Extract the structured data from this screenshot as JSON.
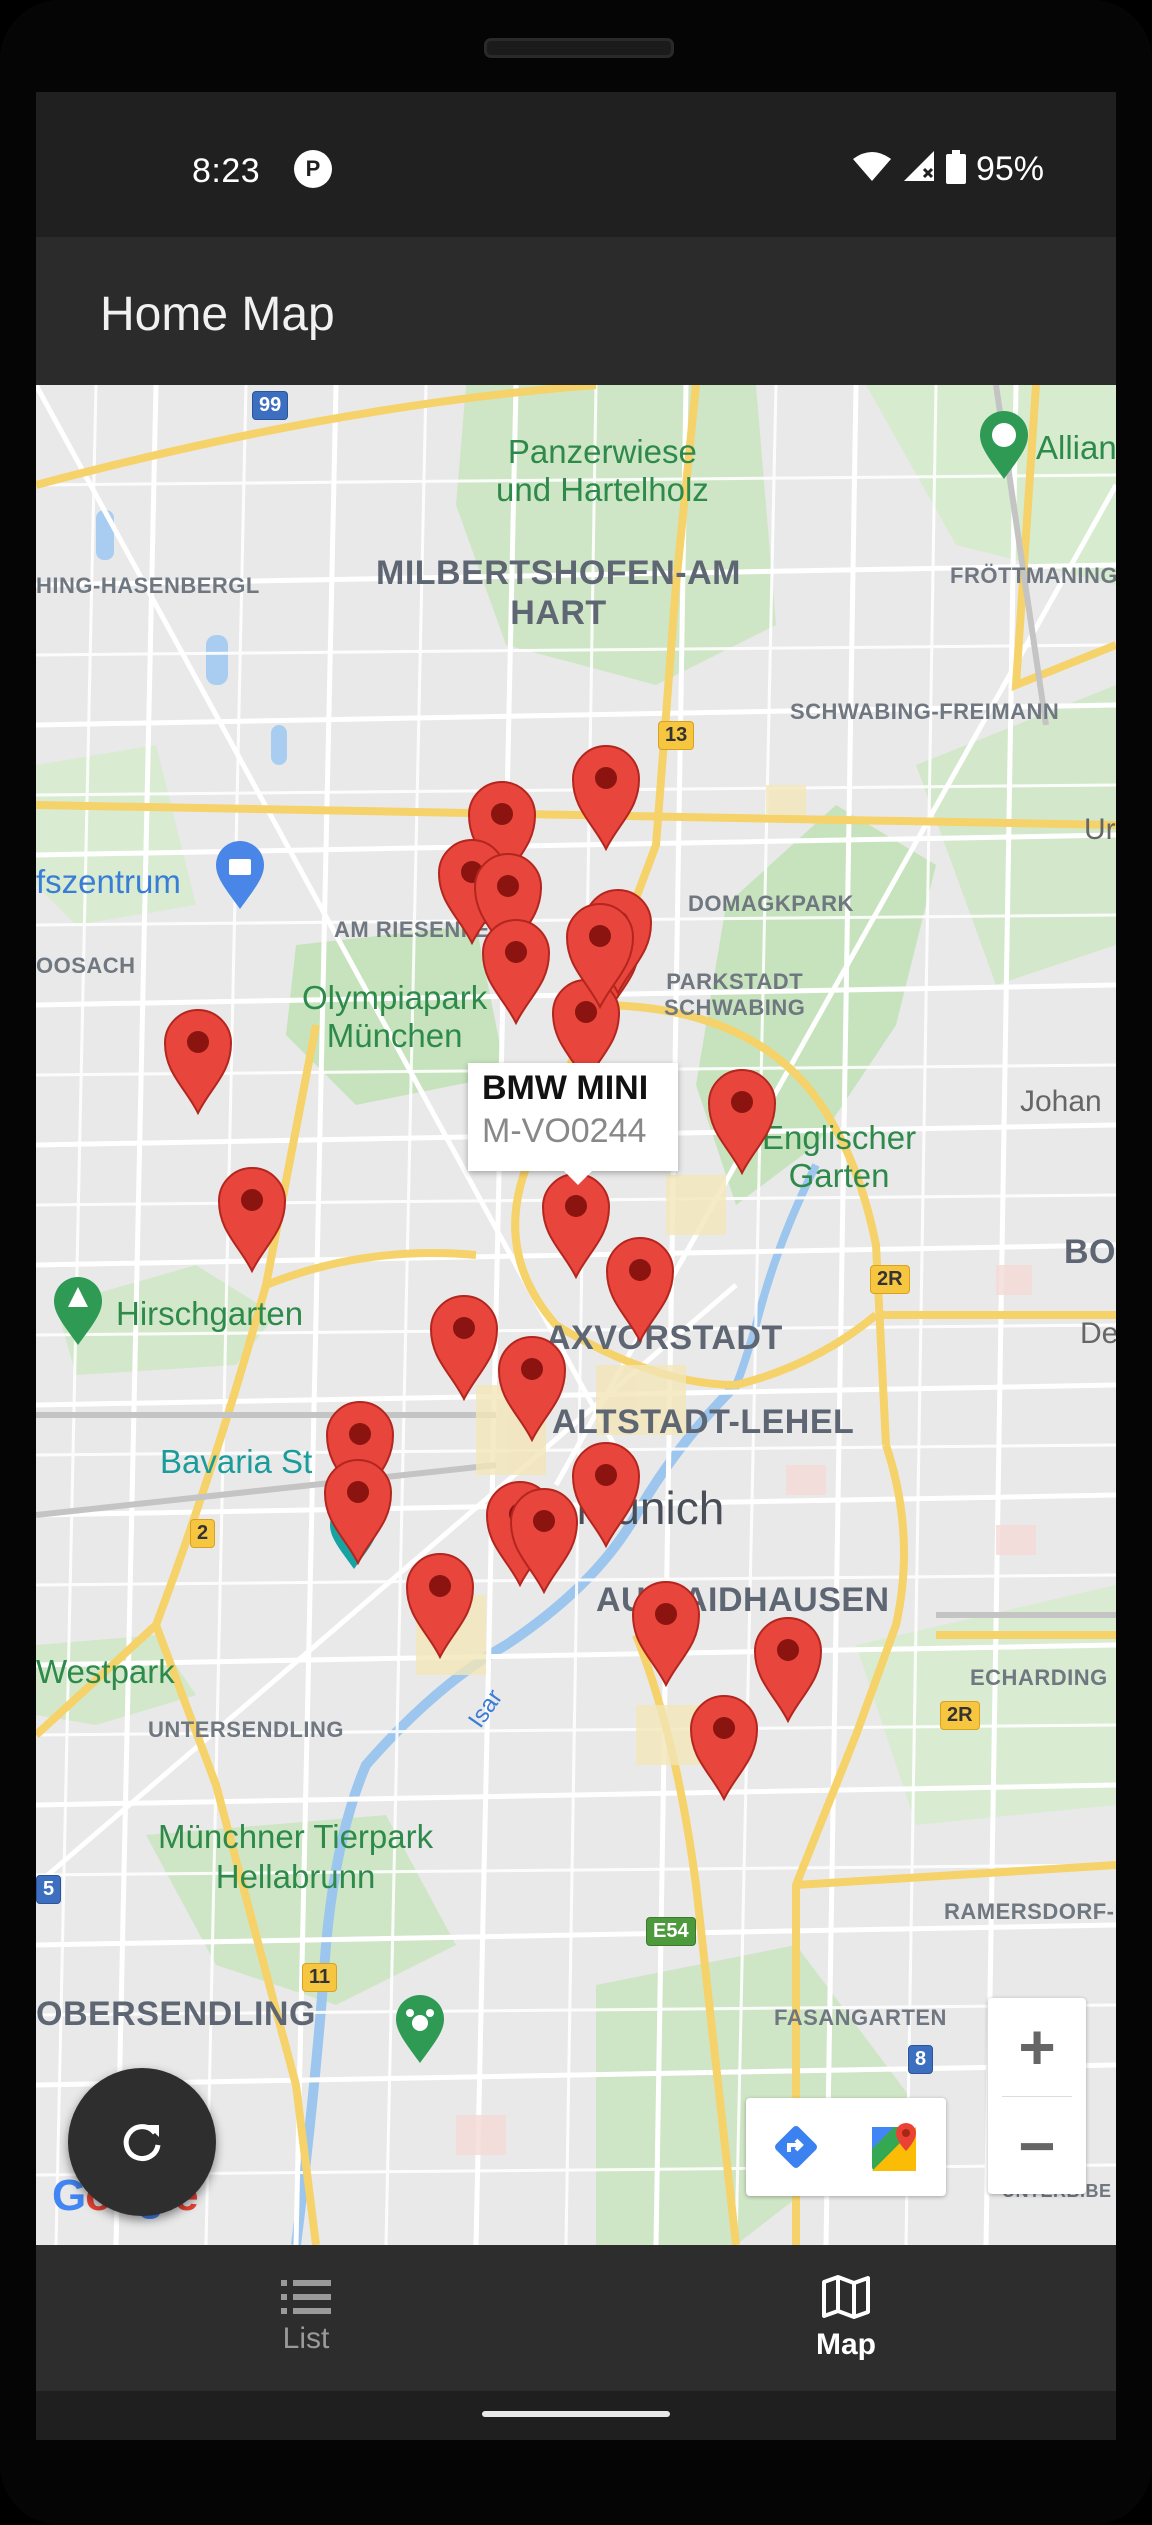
{
  "status_bar": {
    "time": "8:23",
    "notification_icon": "P",
    "battery": "95%"
  },
  "app_bar": {
    "title": "Home Map"
  },
  "map": {
    "labels": {
      "panzerwiese": "Panzerwiese\nund Hartelholz",
      "milbertshofen": "MILBERTSHOFEN-AM\nHART",
      "hasenbergl": "HING-HASENBERGL",
      "froettmaning": "FRÖTTMANING",
      "schwabing_freimann": "SCHWABING-FREIMANN",
      "domagkpark": "DOMAGKPARK",
      "parkstadt": "PARKSTADT\nSCHWABING",
      "am_riesenfeld": "AM RIESENFE",
      "olympiapark": "Olympiapark\nMünchen",
      "oosach": "OOSACH",
      "einkaufszentrum": "fszentrum",
      "englischer_garten": "Englischer\nGarten",
      "johan": "Johan",
      "allianz": "Allian",
      "ur": "Ur",
      "bo": "BO",
      "de": "De",
      "hirschgarten": "Hirschgarten",
      "maxvorstadt": "AXVORSTADT",
      "altstadt": "ALTSTADT-LEHEL",
      "bavaria": "Bavaria St",
      "munich": "Munich",
      "au_haidhausen": "AU-HAIDHAUSEN",
      "westpark": "Westpark",
      "untersendling": "UNTERSENDLING",
      "isar": "Isar",
      "echarding": "ECHARDING",
      "tierpark": "Münchner Tierpark\nHellabrunn",
      "ramersdorf": "RAMERSDORF-P",
      "obersendling": "OBERSENDLING",
      "fasangarten": "FASANGARTEN",
      "unterbiberg": "UNTERBIBE"
    },
    "road_shields": {
      "a99": "99",
      "r13": "13",
      "r2r_a": "2R",
      "r2r_b": "2R",
      "r2": "2",
      "e54": "E54",
      "r11": "11",
      "r8": "8",
      "r5": "5"
    },
    "info_window": {
      "title": "BMW MINI",
      "subtitle": "M-VO0244"
    },
    "marker_color": "#e8453c",
    "marker_count": 25,
    "zoom_in_label": "+",
    "zoom_out_label": "−",
    "google_logo": "Google"
  },
  "fab": {
    "icon": "refresh-icon"
  },
  "bottom_nav": {
    "items": [
      {
        "label": "List",
        "icon": "list-icon",
        "active": false
      },
      {
        "label": "Map",
        "icon": "map-icon",
        "active": true
      }
    ]
  }
}
